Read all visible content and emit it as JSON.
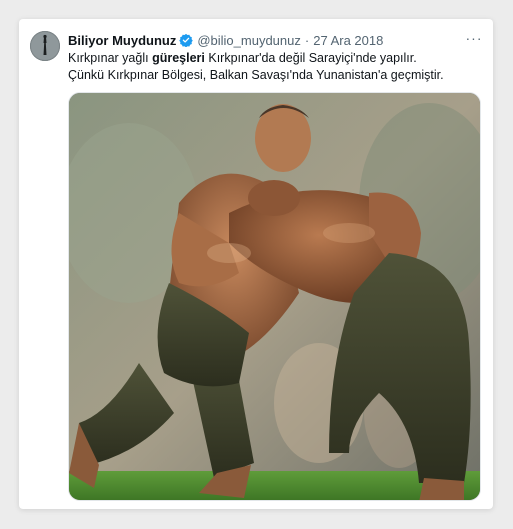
{
  "tweet": {
    "display_name": "Biliyor Muydunuz",
    "handle": "@bilio_muydunuz",
    "separator": "·",
    "date": "27 Ara 2018",
    "text": {
      "line1_part1": "Kırkpınar yağlı ",
      "line1_bold": "güreşleri",
      "line1_part2": " Kırkpınar'da değil Sarayiçi'nde yapılır.",
      "line2": "Çünkü Kırkpınar Bölgesi, Balkan Savaşı'nda Yunanistan'a geçmiştir."
    },
    "more_label": "···"
  },
  "icons": {
    "verified": "verified-badge-icon",
    "more": "more-options-icon",
    "avatar": "profile-avatar"
  },
  "colors": {
    "verified_blue": "#1d9bf0",
    "text_primary": "#0f1419",
    "text_secondary": "#536471"
  }
}
